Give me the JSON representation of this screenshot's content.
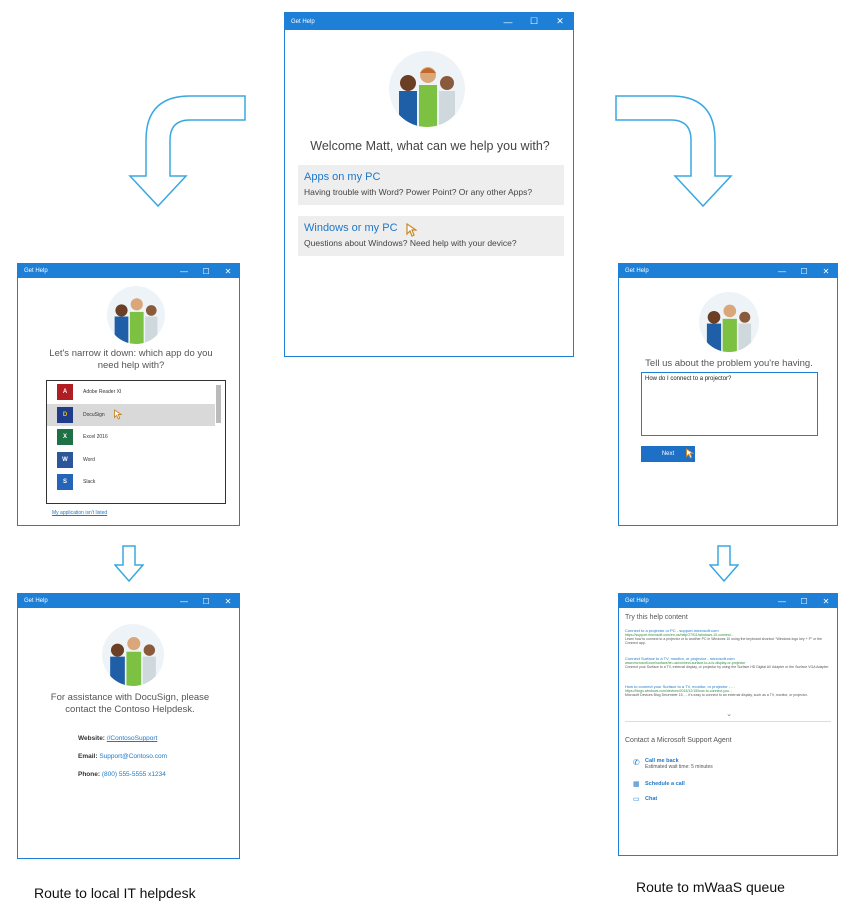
{
  "window_title": "Get Help",
  "titlebar_controls": [
    "—",
    "☐",
    "✕"
  ],
  "main": {
    "welcome": "Welcome Matt, what can we help you with?",
    "options": [
      {
        "title": "Apps on my PC",
        "desc": "Having trouble with Word? Power Point? Or any other Apps?"
      },
      {
        "title": "Windows or my PC",
        "desc": "Questions about Windows? Need help with your device?"
      }
    ]
  },
  "narrow": {
    "prompt": "Let's narrow it down: which app do you need help with?",
    "apps": [
      {
        "name": "Adobe Reader XI",
        "color": "#b01e23",
        "glyph": "A"
      },
      {
        "name": "DocuSign",
        "color": "#1f3c8a",
        "glyph": "D"
      },
      {
        "name": "Excel 2016",
        "color": "#1e7145",
        "glyph": "X"
      },
      {
        "name": "Word",
        "color": "#2b579a",
        "glyph": "W"
      },
      {
        "name": "Slack",
        "color": "#2664b8",
        "glyph": "S"
      }
    ],
    "not_listed": "My application isn't listed"
  },
  "helpdesk": {
    "message": "For assistance with DocuSign, please contact the Contoso Helpdesk.",
    "website_label": "Website:",
    "website_value": "//ContosoSupport",
    "email_label": "Email:",
    "email_value": "Support@Contoso.com",
    "phone_label": "Phone:",
    "phone_value": "(800) 555-5555 x1234"
  },
  "problem": {
    "prompt": "Tell us about the problem you're having.",
    "input_value": "How do I connect to a projector?",
    "next_label": "Next"
  },
  "content": {
    "heading": "Try this help content",
    "results": [
      {
        "title": "Connect to a projector or PC - support.microsoft.com",
        "url": "https://support.microsoft.com/en-us/help/27911/windows-10-connect...",
        "desc": "Learn how to connect to a projector or to another PC in Windows 10 using the keyboard shortcut \"Windows logo key + P\" or the Connect app."
      },
      {
        "title": "Connect Surface to a TV, monitor, or projector - microsoft.com",
        "url": "www.microsoft.com/surface/en-us/connect-surface-to-a-tv-display-or-projector",
        "desc": "Connect your Surface to a TV, external display, or projector by using the Surface HD Digital AV Adapter or the Surface VGA Adapter."
      },
      {
        "title": "How to connect your Surface to a TV, monitor, or projector - ...",
        "url": "https://blogs.windows.com/devices/2015/12/15/how-to-connect-you...",
        "desc": "Microsoft Devices Blog December 15, ... it's easy to connect to an external display, such as a TV, monitor, or projector."
      }
    ],
    "agent_heading": "Contact a Microsoft Support Agent",
    "call_back": "Call me back",
    "wait_time": "Estimated wait time: 5 minutes",
    "schedule": "Schedule a call",
    "chat": "Chat"
  },
  "captions": {
    "left": "Route to local IT helpdesk",
    "right": "Route to mWaaS queue"
  }
}
